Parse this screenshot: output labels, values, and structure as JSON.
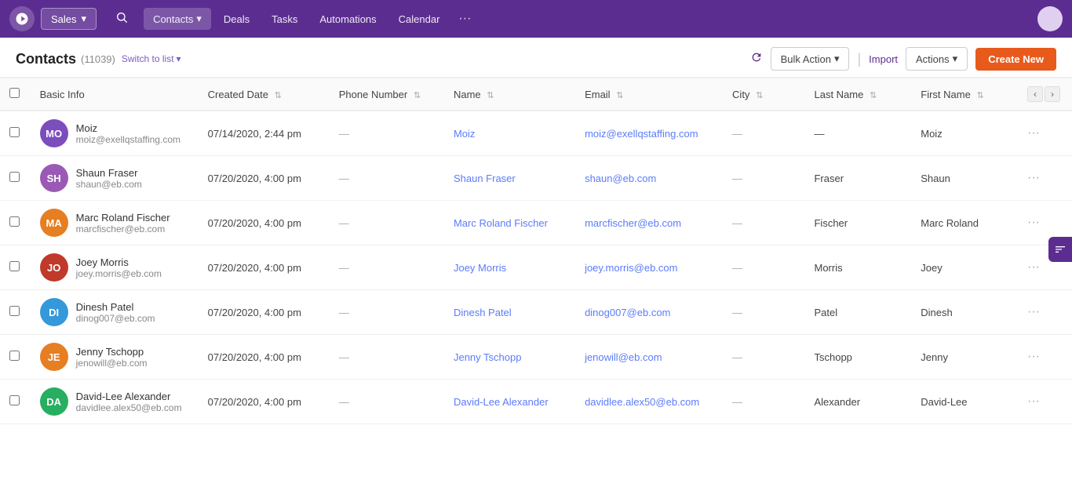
{
  "nav": {
    "logo": "♫",
    "sales_label": "Sales",
    "items": [
      {
        "label": "Contacts",
        "active": true,
        "has_arrow": true
      },
      {
        "label": "Deals",
        "active": false
      },
      {
        "label": "Tasks",
        "active": false
      },
      {
        "label": "Automations",
        "active": false
      },
      {
        "label": "Calendar",
        "active": false
      },
      {
        "label": "···",
        "active": false
      }
    ]
  },
  "page": {
    "title": "Contacts",
    "count": "(11039)",
    "switch_label": "Switch to list",
    "refresh_icon": "↻",
    "bulk_action_label": "Bulk Action",
    "import_label": "Import",
    "actions_label": "Actions",
    "create_label": "Create New"
  },
  "table": {
    "columns": [
      {
        "label": "Basic Info",
        "sortable": false
      },
      {
        "label": "Created Date",
        "sortable": true
      },
      {
        "label": "Phone Number",
        "sortable": true
      },
      {
        "label": "Name",
        "sortable": true
      },
      {
        "label": "Email",
        "sortable": true
      },
      {
        "label": "City",
        "sortable": true
      },
      {
        "label": "Last Name",
        "sortable": true
      },
      {
        "label": "First Name",
        "sortable": true
      }
    ],
    "rows": [
      {
        "initials": "MO",
        "avatar_color": "#7c4dbd",
        "name": "Moiz",
        "email_sub": "moiz@exellqstaffing.com",
        "created": "07/14/2020, 2:44 pm",
        "phone": "—",
        "full_name": "Moiz",
        "email": "moiz@exellqstaffing.com",
        "city": "—",
        "last_name": "—",
        "first_name": "Moiz"
      },
      {
        "initials": "SH",
        "avatar_color": "#9b59b6",
        "name": "Shaun Fraser",
        "email_sub": "shaun@eb.com",
        "created": "07/20/2020, 4:00 pm",
        "phone": "—",
        "full_name": "Shaun Fraser",
        "email": "shaun@eb.com",
        "city": "—",
        "last_name": "Fraser",
        "first_name": "Shaun"
      },
      {
        "initials": "MA",
        "avatar_color": "#e67e22",
        "name": "Marc Roland Fischer",
        "email_sub": "marcfischer@eb.com",
        "created": "07/20/2020, 4:00 pm",
        "phone": "—",
        "full_name": "Marc Roland Fischer",
        "email": "marcfischer@eb.com",
        "city": "—",
        "last_name": "Fischer",
        "first_name": "Marc Roland"
      },
      {
        "initials": "JO",
        "avatar_color": "#c0392b",
        "name": "Joey Morris",
        "email_sub": "joey.morris@eb.com",
        "created": "07/20/2020, 4:00 pm",
        "phone": "—",
        "full_name": "Joey Morris",
        "email": "joey.morris@eb.com",
        "city": "—",
        "last_name": "Morris",
        "first_name": "Joey"
      },
      {
        "initials": "DI",
        "avatar_color": "#3498db",
        "name": "Dinesh Patel",
        "email_sub": "dinog007@eb.com",
        "created": "07/20/2020, 4:00 pm",
        "phone": "—",
        "full_name": "Dinesh Patel",
        "email": "dinog007@eb.com",
        "city": "—",
        "last_name": "Patel",
        "first_name": "Dinesh"
      },
      {
        "initials": "JE",
        "avatar_color": "#e67e22",
        "name": "Jenny Tschopp",
        "email_sub": "jenowill@eb.com",
        "created": "07/20/2020, 4:00 pm",
        "phone": "—",
        "full_name": "Jenny Tschopp",
        "email": "jenowill@eb.com",
        "city": "—",
        "last_name": "Tschopp",
        "first_name": "Jenny"
      },
      {
        "initials": "DA",
        "avatar_color": "#27ae60",
        "name": "David-Lee Alexander",
        "email_sub": "davidlee.alex50@eb.com",
        "created": "07/20/2020, 4:00 pm",
        "phone": "—",
        "full_name": "David-Lee Alexander",
        "email": "davidlee.alex50@eb.com",
        "city": "—",
        "last_name": "Alexander",
        "first_name": "David-Lee"
      }
    ]
  }
}
